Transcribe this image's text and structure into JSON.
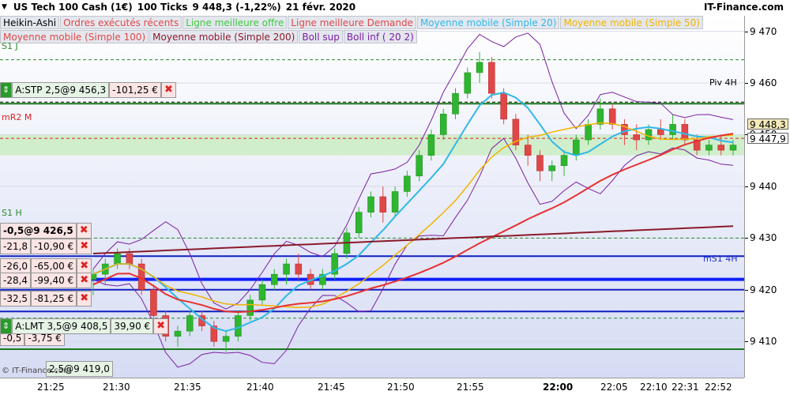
{
  "header": {
    "instrument": "US Tech 100 Cash (1€)",
    "ticks": "100 Ticks",
    "price_change": "9 448,3 (-1,22%)",
    "date": "21 févr. 2020",
    "brand": "IT-Finance.com"
  },
  "legend": {
    "row1": [
      "Heikin-Ashi",
      "Ordres exécutés récents",
      "Ligne meilleure offre",
      "Ligne meilleure Demande",
      "Moyenne mobile (Simple 20)",
      "Moyenne mobile (Simple 50)"
    ],
    "row2": [
      "Moyenne mobile (Simple 100)",
      "Moyenne mobile (Simple 200)",
      "Boll sup",
      "Boll inf ( 20 2)"
    ],
    "row1_colors": [
      "#000000",
      "#e04848",
      "#40c840",
      "#e04848",
      "#30b8e8",
      "#f0b400"
    ],
    "row2_colors": [
      "#e04848",
      "#8b1a2a",
      "#7a1fa2",
      "#7a1fa2"
    ]
  },
  "price_axis": {
    "ticks": [
      "9 470",
      "9 460",
      "9 450",
      "9 440",
      "9 430",
      "9 420",
      "9 410"
    ],
    "current_bid": "9 448,3",
    "current_ask": "9 447,9"
  },
  "time_axis": {
    "ticks": [
      "21:25",
      "21:30",
      "21:35",
      "21:40",
      "21:45",
      "21:50",
      "21:55",
      "22:00",
      "22:05",
      "22:10",
      "22:31",
      "22:52"
    ],
    "bold_index": 7
  },
  "levels": {
    "s1_top": "S1 J",
    "piv": "Piv 4H",
    "mr2": "mR2 M",
    "s1h": "S1 H",
    "ms1": "mS1 4H"
  },
  "orders": {
    "stop": {
      "label": "A:STP  2,5@9 456,3",
      "pnl": "-101,25 €"
    },
    "limit": {
      "label": "A:LMT  3,5@9 408,5",
      "pnl": "39,90 €"
    },
    "position": {
      "label": "-0,5@9 426,5"
    },
    "rows": [
      {
        "a": "-21,8",
        "b": "-10,90 €"
      },
      {
        "a": "-26,0",
        "b": "-65,00 €"
      },
      {
        "a": "-28,4",
        "b": "-99,40 €"
      },
      {
        "a": "-32,5",
        "b": "-81,25 €"
      },
      {
        "a": "-0,5",
        "b": "-3,75 €"
      }
    ],
    "bottom": "2,5@9 419,0"
  },
  "watermark": "© IT-Finance.com",
  "chart_data": {
    "type": "candlestick",
    "series": [
      {
        "name": "Heikin-Ashi",
        "ohlc": [
          [
            9422,
            9424,
            9419,
            9423
          ],
          [
            9423,
            9426,
            9421,
            9425
          ],
          [
            9425,
            9428,
            9424,
            9427
          ],
          [
            9427,
            9428,
            9424,
            9425
          ],
          [
            9425,
            9426,
            9419,
            9420
          ],
          [
            9420,
            9421,
            9414,
            9415
          ],
          [
            9415,
            9416,
            9410,
            9411
          ],
          [
            9411,
            9413,
            9409,
            9412
          ],
          [
            9412,
            9416,
            9411,
            9415
          ],
          [
            9415,
            9416,
            9412,
            9413
          ],
          [
            9413,
            9414,
            9409,
            9410
          ],
          [
            9410,
            9412,
            9408,
            9411
          ],
          [
            9411,
            9416,
            9410,
            9415
          ],
          [
            9415,
            9419,
            9414,
            9418
          ],
          [
            9418,
            9422,
            9417,
            9421
          ],
          [
            9421,
            9424,
            9420,
            9423
          ],
          [
            9423,
            9426,
            9421,
            9425
          ],
          [
            9425,
            9427,
            9422,
            9423
          ],
          [
            9423,
            9424,
            9420,
            9421
          ],
          [
            9421,
            9424,
            9420,
            9423
          ],
          [
            9423,
            9428,
            9422,
            9427
          ],
          [
            9427,
            9432,
            9426,
            9431
          ],
          [
            9431,
            9436,
            9430,
            9435
          ],
          [
            9435,
            9439,
            9434,
            9438
          ],
          [
            9438,
            9440,
            9433,
            9435
          ],
          [
            9435,
            9440,
            9434,
            9439
          ],
          [
            9439,
            9443,
            9438,
            9442
          ],
          [
            9442,
            9447,
            9441,
            9446
          ],
          [
            9446,
            9451,
            9445,
            9450
          ],
          [
            9450,
            9455,
            9449,
            9454
          ],
          [
            9454,
            9459,
            9453,
            9458
          ],
          [
            9458,
            9463,
            9457,
            9462
          ],
          [
            9462,
            9466,
            9460,
            9464
          ],
          [
            9464,
            9465,
            9457,
            9458
          ],
          [
            9458,
            9459,
            9452,
            9453
          ],
          [
            9453,
            9454,
            9447,
            9448
          ],
          [
            9448,
            9450,
            9444,
            9446
          ],
          [
            9446,
            9447,
            9441,
            9443
          ],
          [
            9443,
            9445,
            9441,
            9444
          ],
          [
            9444,
            9447,
            9442,
            9446
          ],
          [
            9446,
            9450,
            9445,
            9449
          ],
          [
            9449,
            9453,
            9448,
            9452
          ],
          [
            9452,
            9457,
            9451,
            9455
          ],
          [
            9455,
            9456,
            9451,
            9452
          ],
          [
            9452,
            9453,
            9448,
            9450
          ],
          [
            9450,
            9452,
            9447,
            9449
          ],
          [
            9449,
            9452,
            9448,
            9451
          ],
          [
            9451,
            9453,
            9449,
            9450
          ],
          [
            9450,
            9454,
            9449,
            9452
          ],
          [
            9452,
            9453,
            9448,
            9449
          ],
          [
            9449,
            9450,
            9446,
            9447
          ],
          [
            9447,
            9449,
            9446,
            9448
          ],
          [
            9448,
            9450,
            9446,
            9447
          ],
          [
            9447,
            9449,
            9446,
            9448
          ]
        ]
      }
    ],
    "ylim": [
      9403,
      9473
    ],
    "grid": true
  }
}
